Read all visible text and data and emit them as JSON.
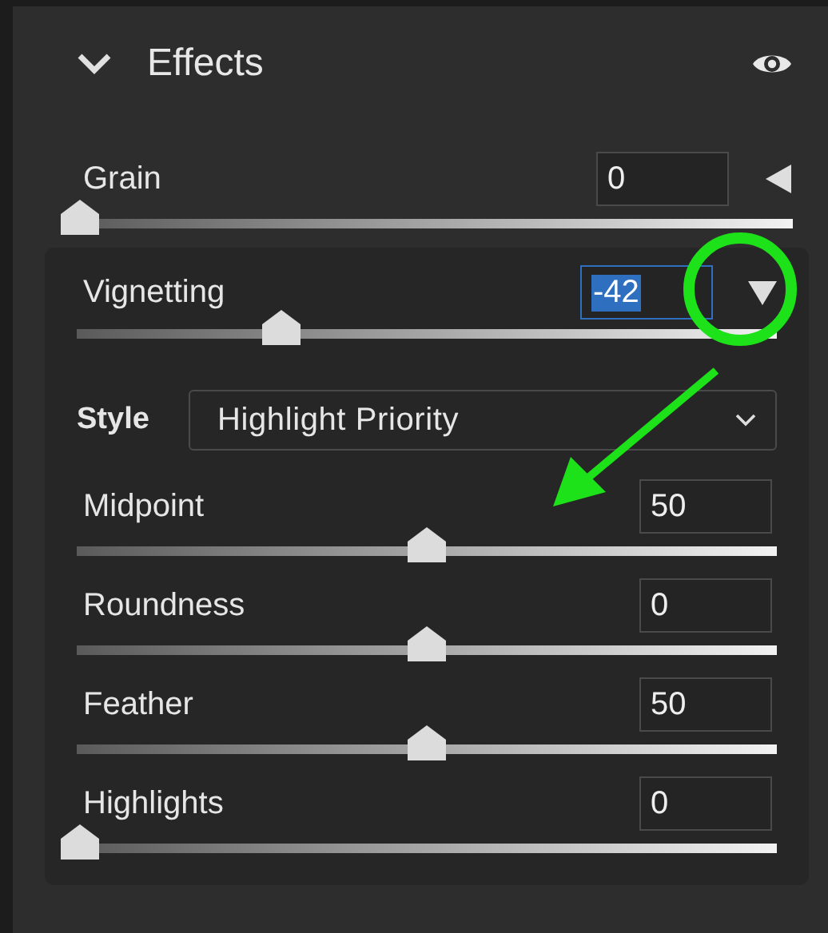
{
  "panel": {
    "title": "Effects",
    "expanded": true
  },
  "grain": {
    "label": "Grain",
    "value": "0",
    "level": 0,
    "expanded": false
  },
  "vignetting": {
    "label": "Vignetting",
    "value": "-42",
    "value_selected": true,
    "level": 0.29,
    "expanded": true,
    "style": {
      "label": "Style",
      "value": "Highlight Priority"
    },
    "sliders": [
      {
        "label": "Midpoint",
        "value": "50",
        "level": 0.5
      },
      {
        "label": "Roundness",
        "value": "0",
        "level": 0.5
      },
      {
        "label": "Feather",
        "value": "50",
        "level": 0.5
      },
      {
        "label": "Highlights",
        "value": "0",
        "level": 0
      }
    ]
  },
  "annotation": {
    "circle": true,
    "arrow": true
  }
}
